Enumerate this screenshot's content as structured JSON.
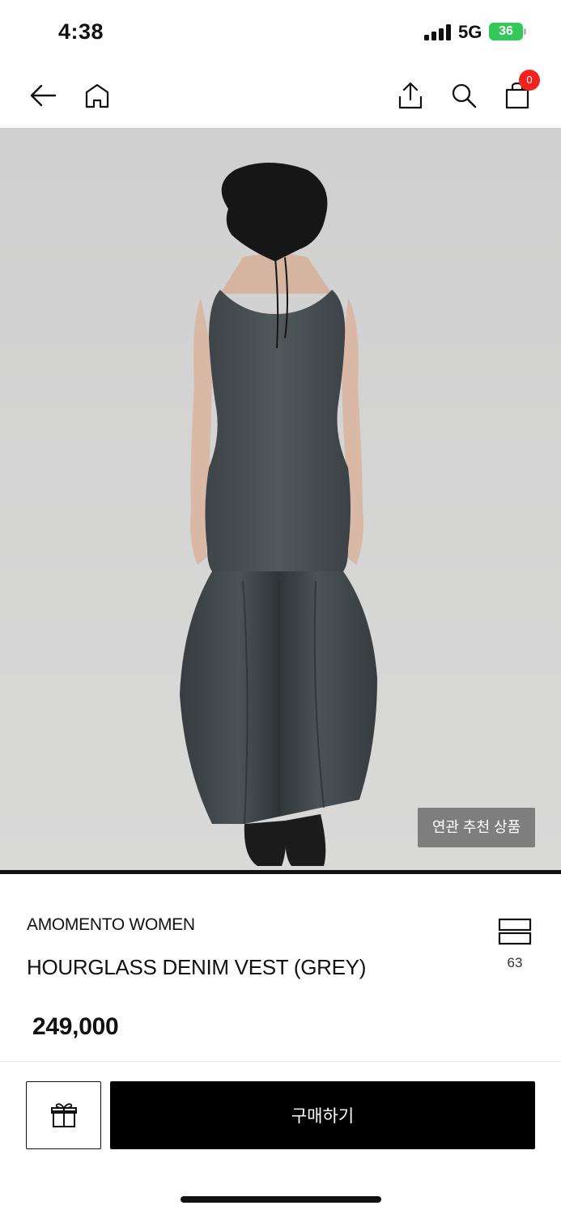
{
  "status": {
    "time": "4:38",
    "network": "5G",
    "battery": "36"
  },
  "nav": {
    "back_icon": "arrow-left-icon",
    "home_icon": "home-icon",
    "share_icon": "share-icon",
    "search_icon": "search-icon",
    "cart_icon": "shopping-bag-icon",
    "cart_count": "0"
  },
  "hero": {
    "image": "model-back-view-grey-denim-vest-dress",
    "related_label": "연관 추천 상품"
  },
  "product": {
    "brand": "AMOMENTO WOMEN",
    "name": "HOURGLASS DENIM VEST (GREY)",
    "price": "249,000",
    "like_count": "63",
    "like_icon": "stack-icon"
  },
  "actions": {
    "gift_icon": "gift-icon",
    "buy_label": "구매하기"
  },
  "colors": {
    "accent": "#000000",
    "badge": "#f2231f",
    "battery": "#34c759"
  }
}
